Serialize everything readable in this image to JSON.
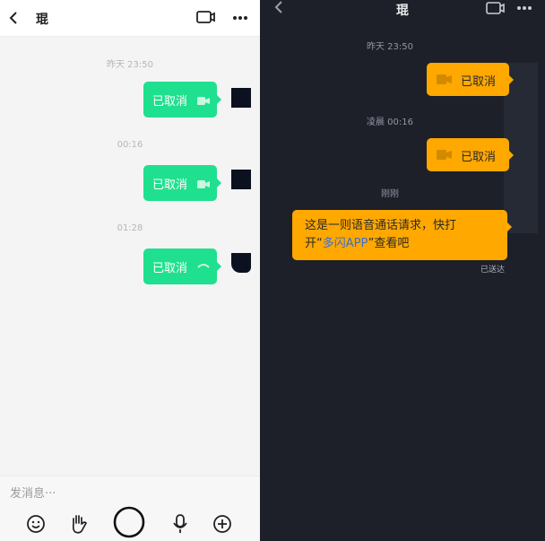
{
  "left": {
    "header": {
      "title": "琨"
    },
    "messages": [
      {
        "time": "昨天 23:50",
        "label": "已取消"
      },
      {
        "time": "00:16",
        "label": "已取消"
      },
      {
        "time": "01:28",
        "label": "已取消"
      }
    ],
    "input": {
      "placeholder": "发消息···"
    },
    "toolbar": [
      "emoji-icon",
      "wave-hand-icon",
      "shutter-icon",
      "microphone-icon",
      "plus-circle-icon"
    ]
  },
  "right": {
    "header": {
      "title": "琨"
    },
    "messages": [
      {
        "time": "昨天 23:50",
        "label": "已取消"
      },
      {
        "time": "凌晨 00:16",
        "label": "已取消"
      }
    ],
    "notice": {
      "time": "刚刚",
      "line1": "这是一则语音通话请求，快打",
      "line2_prefix": "开“",
      "link": "多闪APP",
      "line2_suffix": "”查看吧",
      "status": "已送达"
    }
  },
  "colors": {
    "green_bubble": "#1fe08e",
    "orange_bubble": "#ffa800",
    "dark_bg": "#1d2029",
    "link": "#3a6fd8"
  }
}
